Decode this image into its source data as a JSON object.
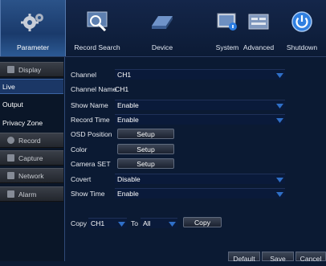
{
  "menu": {
    "items": [
      {
        "label": "Parameter",
        "icon": "gears-icon"
      },
      {
        "label": "Record Search",
        "icon": "magnifier-icon"
      },
      {
        "label": "Device",
        "icon": "hard-drive-icon"
      },
      {
        "label": "System",
        "icon": "system-info-icon"
      },
      {
        "label": "Advanced",
        "icon": "advanced-settings-icon"
      },
      {
        "label": "Shutdown",
        "icon": "power-icon"
      }
    ],
    "active_index": 0
  },
  "sidebar": {
    "items": [
      {
        "label": "Display",
        "type": "category",
        "icon": "display-icon"
      },
      {
        "label": "Live",
        "type": "sub",
        "active": true
      },
      {
        "label": "Output",
        "type": "sub"
      },
      {
        "label": "Privacy Zone",
        "type": "sub"
      },
      {
        "label": "Record",
        "type": "category",
        "icon": "record-icon"
      },
      {
        "label": "Capture",
        "type": "category",
        "icon": "capture-icon"
      },
      {
        "label": "Network",
        "type": "category",
        "icon": "network-icon"
      },
      {
        "label": "Alarm",
        "type": "category",
        "icon": "alarm-icon"
      }
    ]
  },
  "form": {
    "channel": {
      "label": "Channel",
      "value": "CH1"
    },
    "channel_name": {
      "label": "Channel Name",
      "value": "CH1"
    },
    "show_name": {
      "label": "Show Name",
      "value": "Enable"
    },
    "record_time": {
      "label": "Record Time",
      "value": "Enable"
    },
    "osd_position": {
      "label": "OSD Position",
      "button": "Setup"
    },
    "color": {
      "label": "Color",
      "button": "Setup"
    },
    "camera_set": {
      "label": "Camera SET",
      "button": "Setup"
    },
    "covert": {
      "label": "Covert",
      "value": "Disable"
    },
    "show_time": {
      "label": "Show Time",
      "value": "Enable"
    }
  },
  "copy": {
    "label": "Copy",
    "from_value": "CH1",
    "to_label": "To",
    "to_value": "All",
    "button": "Copy"
  },
  "footer": {
    "default": "Default",
    "save": "Save",
    "cancel": "Cancel"
  },
  "colors": {
    "background": "#0b1a33",
    "accent_blue": "#2f6fc7",
    "active_tab": "#1a3a6b"
  }
}
